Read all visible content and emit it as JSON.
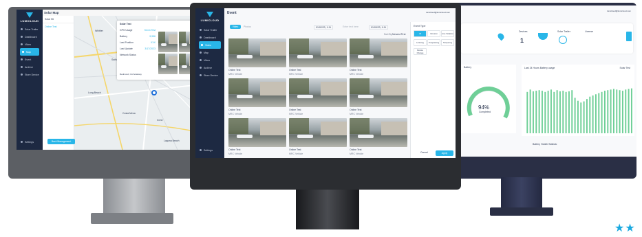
{
  "brand": {
    "name": "LUMICLOUD"
  },
  "left_screen": {
    "title": "Solar Map",
    "nav": [
      "Solar Trailer",
      "Dashboard",
      "Video",
      "Map",
      "Event",
      "Archive",
      "Store Device"
    ],
    "active_nav": "Map",
    "settings_label": "Settings",
    "list_labels": [
      "Solar 56",
      "Online Test"
    ],
    "info_title": "Solar Test",
    "info_rows": [
      "GPS Usage",
      "Battery",
      "Last Position",
      "Last Update",
      "Network Status"
    ],
    "info_values": [
      "Kevin Test",
      "9,956",
      "XXX",
      "3/17/2023"
    ],
    "address": "Redmond, CA Solarway",
    "bottom_button": "Back Management",
    "map_labels": [
      "Santa Ana",
      "Long Beach",
      "Costa Mesa",
      "Irvine",
      "Laguna Beach",
      "Whittier"
    ]
  },
  "center_screen": {
    "title": "Event",
    "nav": [
      "Solar Trailer",
      "Dashboard",
      "Video",
      "Map",
      "Video",
      "Archive",
      "Store Device"
    ],
    "active_nav": "Video",
    "settings_label": "Settings",
    "tabs": [
      "Video",
      "Photos"
    ],
    "date_from": "01/02/23, 1:11",
    "date_to": "01/03/23, 1:11",
    "search_placeholder": "Enter text here",
    "filter_label": "Filter",
    "sort_label": "Sort By",
    "sort_value": "Newest First",
    "user_label": "lumicloud@lumicloud.com",
    "events": [
      {
        "name": "Online Test",
        "device": "MRC Vehicle"
      },
      {
        "name": "Online Test",
        "device": "MRC Vehicle"
      },
      {
        "name": "Online Test",
        "device": "MRC Vehicle"
      },
      {
        "name": "Online Test",
        "device": "MRC Vehicle"
      },
      {
        "name": "Online Test",
        "device": "MRC Vehicle"
      },
      {
        "name": "Online Test",
        "device": "MRC Vehicle"
      },
      {
        "name": "Online Test",
        "device": "MRC Vehicle"
      },
      {
        "name": "Online Test",
        "device": "MRC Vehicle"
      },
      {
        "name": "Online Test",
        "device": "MRC Vehicle"
      }
    ],
    "filter_panel": {
      "title": "Event Type",
      "chips": [
        "All",
        "Intrusion",
        "Line Violation",
        "Loitering",
        "Trespassing",
        "Tampering",
        "Device Change"
      ],
      "cancel": "Cancel",
      "apply": "Apply"
    }
  },
  "right_screen": {
    "user_label": "lumicloud@lumicloud.com",
    "stats": [
      {
        "label": "Devices",
        "value": "1"
      },
      {
        "label": "Solar Trailer",
        "value": ""
      },
      {
        "label": "License",
        "value": ""
      }
    ],
    "battery_title": "Battery",
    "battery_percent": "94%",
    "battery_caption": "Completed",
    "usage_title": "Last 24 Hours Battery usage",
    "usage_unit": "Solar Test",
    "footer_note": "Battery Health Statistic",
    "bar_values": [
      0.7,
      0.74,
      0.71,
      0.72,
      0.73,
      0.72,
      0.7,
      0.72,
      0.74,
      0.7,
      0.73,
      0.71,
      0.72,
      0.7,
      0.71,
      0.73,
      0.6,
      0.55,
      0.52,
      0.54,
      0.58,
      0.62,
      0.64,
      0.66,
      0.68,
      0.7,
      0.72,
      0.73,
      0.74,
      0.75,
      0.74,
      0.73,
      0.72,
      0.74,
      0.75,
      0.76
    ]
  },
  "rating": {
    "stars": "★★"
  },
  "colors": {
    "accent": "#29b6e8",
    "sidebar": "#1d2942",
    "gauge": "#6fcf97",
    "bars": "#6fcf97",
    "right_frame": "#2a2f45"
  }
}
